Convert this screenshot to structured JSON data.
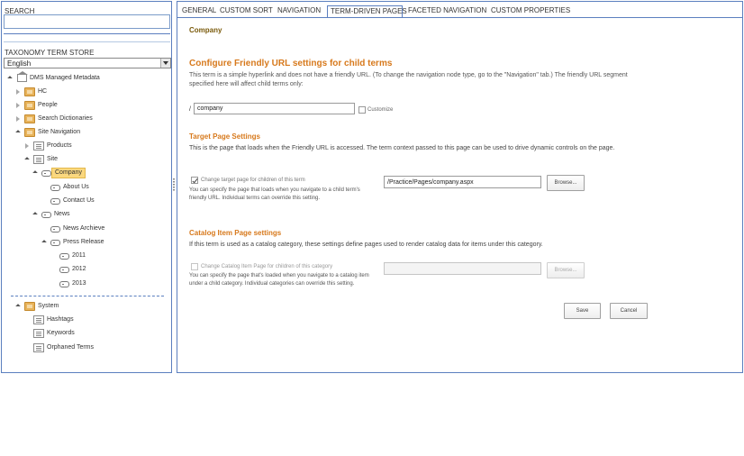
{
  "left": {
    "search_label": "SEARCH",
    "search_value": "",
    "store_label": "TAXONOMY TERM STORE",
    "language": "English",
    "tree": [
      {
        "label": "DMS Managed Metadata",
        "icon": "store-icon"
      },
      {
        "label": "HC",
        "icon": "group-icon"
      },
      {
        "label": "People",
        "icon": "group-icon"
      },
      {
        "label": "Search Dictionaries",
        "icon": "group-icon"
      },
      {
        "label": "Site Navigation",
        "icon": "group-icon"
      },
      {
        "label": "Products",
        "icon": "termset-icon"
      },
      {
        "label": "Site",
        "icon": "termset-icon"
      },
      {
        "label": "Company",
        "icon": "term-icon",
        "selected": true
      },
      {
        "label": "About Us",
        "icon": "term-icon"
      },
      {
        "label": "Contact Us",
        "icon": "term-icon"
      },
      {
        "label": "News",
        "icon": "term-icon"
      },
      {
        "label": "News Archieve",
        "icon": "term-icon"
      },
      {
        "label": "Press Release",
        "icon": "term-icon"
      },
      {
        "label": "2011",
        "icon": "term-icon"
      },
      {
        "label": "2012",
        "icon": "term-icon"
      },
      {
        "label": "2013",
        "icon": "term-icon"
      },
      {
        "label": "System",
        "icon": "group-icon"
      },
      {
        "label": "Hashtags",
        "icon": "termset-icon"
      },
      {
        "label": "Keywords",
        "icon": "termset-icon"
      },
      {
        "label": "Orphaned Terms",
        "icon": "termset-icon"
      }
    ]
  },
  "tabs": [
    "GENERAL",
    "CUSTOM SORT",
    "NAVIGATION",
    "TERM-DRIVEN PAGES",
    "FACETED NAVIGATION",
    "CUSTOM PROPERTIES"
  ],
  "active_tab": "TERM-DRIVEN PAGES",
  "main": {
    "term_title": "Company",
    "friendly_heading": "Configure Friendly URL settings for child terms",
    "friendly_desc": "This term is a simple hyperlink and does not have a friendly URL. (To change the navigation node type, go to the \"Navigation\" tab.) The friendly URL segment specified here will affect child terms only:",
    "url_prefix": "/",
    "url_value": "company",
    "customize_label": "Customize",
    "target_heading": "Target Page Settings",
    "target_desc": "This is the page that loads when the Friendly URL is accessed. The term context passed to this page can be used to drive dynamic controls on the page.",
    "target_checkbox_label": "Change target page for children of this term",
    "target_help": "You can specify the page that loads when you navigate to a child term's friendly URL. Individual terms can override this setting.",
    "target_value": "/Practice/Pages/company.aspx",
    "browse_label": "Browse...",
    "catalog_heading": "Catalog Item Page settings",
    "catalog_desc": "If this term is used as a catalog category, these settings define pages used to render catalog data for items under this category.",
    "catalog_checkbox_label": "Change Catalog Item Page for children of this category",
    "catalog_help": "You can specify the page that's loaded when you navigate to a catalog item under a child category. Individual categories can override this setting.",
    "catalog_value": "",
    "catalog_browse_label": "Browse...",
    "save_label": "Save",
    "cancel_label": "Cancel"
  },
  "colors": {
    "accent_orange": "#d7791c",
    "border_blue": "#5b7fbf",
    "selection": "#fbd87f"
  }
}
